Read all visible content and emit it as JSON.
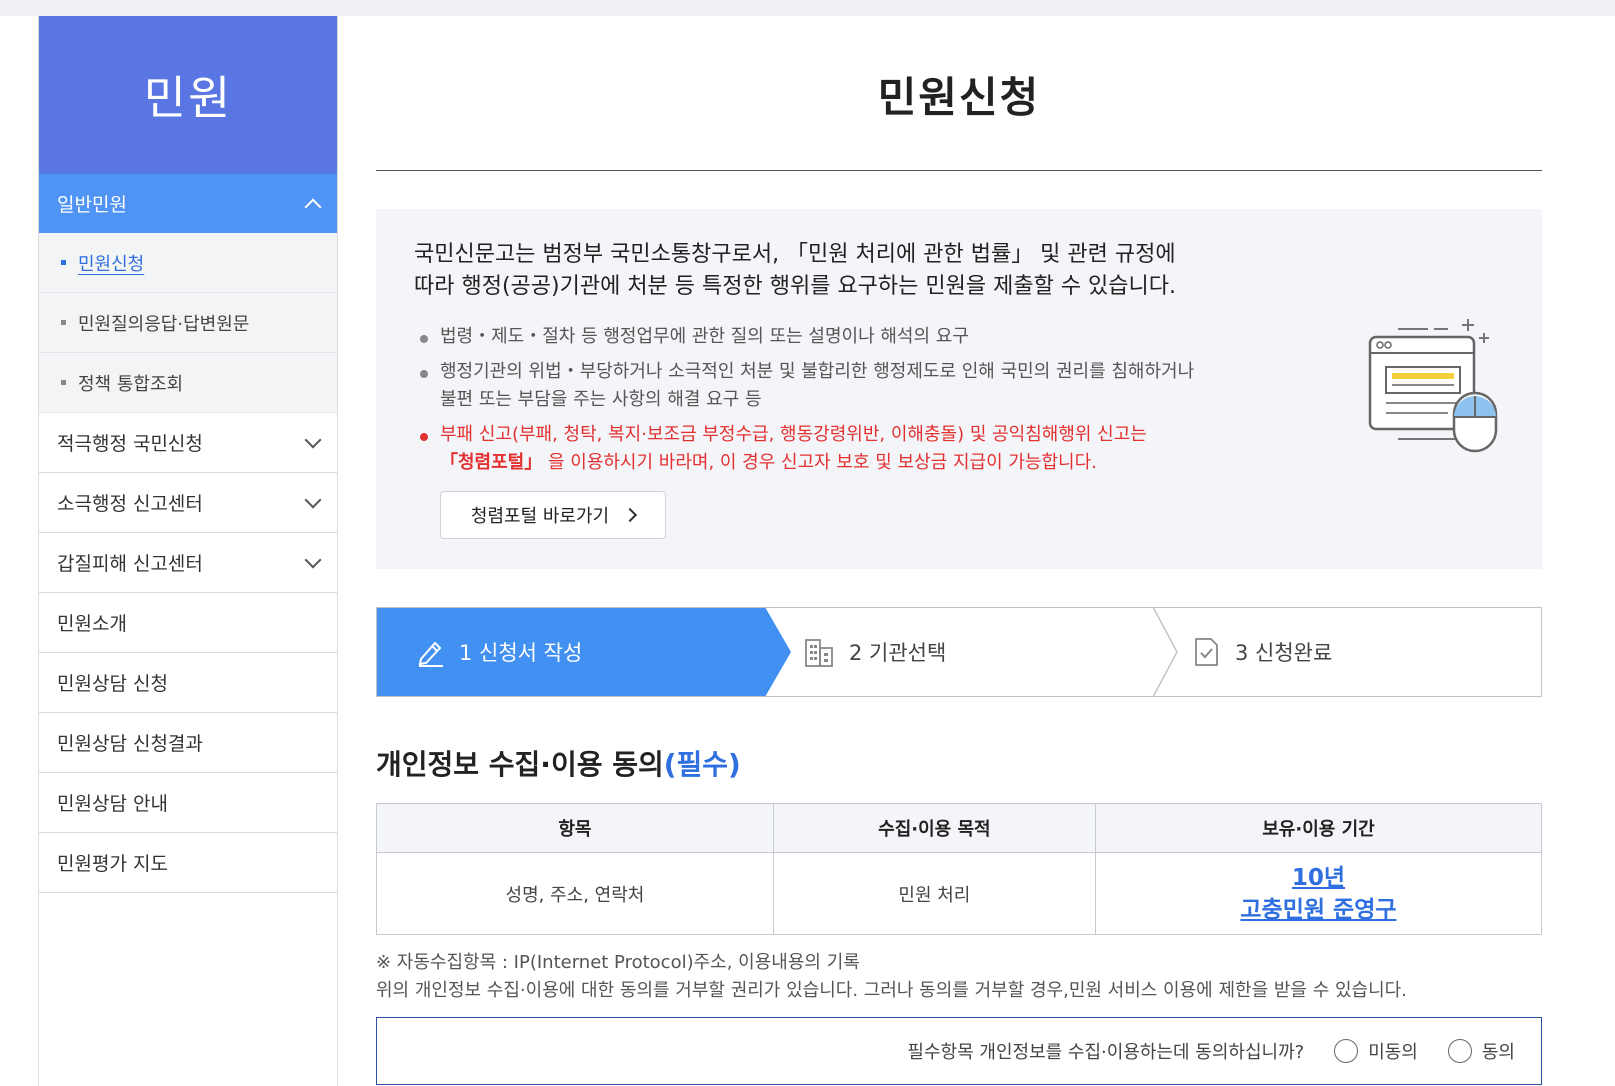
{
  "sidebar": {
    "title": "민원",
    "open_menu": "일반민원",
    "sub_items": [
      {
        "label": "민원신청",
        "active": true
      },
      {
        "label": "민원질의응답·답변원문",
        "active": false
      },
      {
        "label": "정책 통합조회",
        "active": false
      }
    ],
    "menu_items": [
      {
        "label": "적극행정 국민신청",
        "expandable": true
      },
      {
        "label": "소극행정 신고센터",
        "expandable": true
      },
      {
        "label": "갑질피해 신고센터",
        "expandable": true
      },
      {
        "label": "민원소개",
        "expandable": false
      },
      {
        "label": "민원상담 신청",
        "expandable": false
      },
      {
        "label": "민원상담 신청결과",
        "expandable": false
      },
      {
        "label": "민원상담 안내",
        "expandable": false
      },
      {
        "label": "민원평가 지도",
        "expandable": false
      }
    ]
  },
  "main": {
    "page_title": "민원신청",
    "info": {
      "line1": "국민신문고는 범정부 국민소통창구로서, 「민원 처리에 관한 법률」 및 관련 규정에",
      "line2": "따라 행정(공공)기관에 처분 등 특정한 행위를 요구하는 민원을 제출할 수 있습니다.",
      "bullet1": "법령・제도・절차 등 행정업무에 관한 질의 또는 설명이나 해석의 요구",
      "bullet2a": "행정기관의 위법・부당하거나 소극적인 처분 및 불합리한 행정제도로 인해 국민의 권리를 침해하거나",
      "bullet2b": "불편 또는 부담을 주는 사항의 해결 요구 등",
      "bullet3a": "부패 신고(부패, 청탁, 복지·보조금 부정수급, 행동강령위반, 이해충돌) 및 공익침해행위 신고는",
      "bullet3b_bold": "「청렴포털」",
      "bullet3b_rest": " 을 이용하시기 바라며, 이 경우 신고자 보호 및 보상금 지급이 가능합니다.",
      "go_button": "청렴포털 바로가기"
    },
    "steps": [
      {
        "label": "1 신청서 작성",
        "icon": "pencil-icon",
        "active": true
      },
      {
        "label": "2 기관선택",
        "icon": "building-icon",
        "active": false
      },
      {
        "label": "3 신청완료",
        "icon": "document-check-icon",
        "active": false
      }
    ],
    "consent": {
      "title": "개인정보 수집·이용 동의",
      "required": "(필수)",
      "headers": [
        "항목",
        "수집·이용 목적",
        "보유·이용 기간"
      ],
      "row": {
        "item": "성명, 주소, 연락처",
        "purpose": "민원 처리",
        "period_line1": "10년",
        "period_line2": "고충민원 준영구"
      },
      "note1": "※ 자동수집항목 : IP(Internet Protocol)주소, 이용내용의 기록",
      "note2": "위의 개인정보 수집·이용에 대한 동의를 거부할 권리가 있습니다. 그러나 동의를 거부할 경우,민원 서비스 이용에 제한을 받을 수 있습니다.",
      "question": "필수항목 개인정보를 수집·이용하는데 동의하십니까?",
      "option_disagree": "미동의",
      "option_agree": "동의"
    }
  },
  "colors": {
    "sidebar_head": "#5a76e2",
    "menu_open": "#4f94f4",
    "step_active": "#4190f2",
    "link_blue": "#2f6fe0",
    "warning_red": "#e33131"
  }
}
